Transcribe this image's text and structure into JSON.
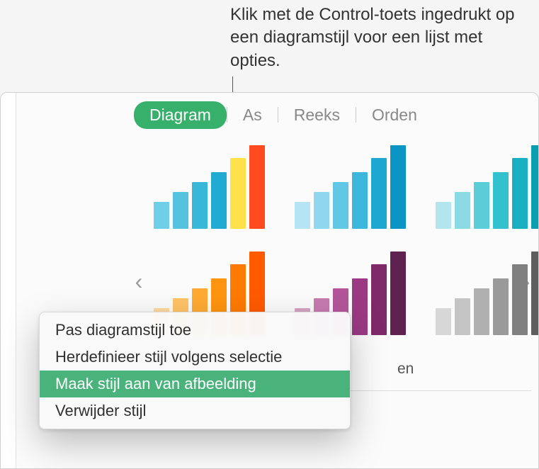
{
  "callout": {
    "text": "Klik met de Control-toets ingedrukt op een diagramstijl voor een lijst met opties."
  },
  "tabs": {
    "items": [
      {
        "label": "Diagram",
        "active": true
      },
      {
        "label": "As",
        "active": false
      },
      {
        "label": "Reeks",
        "active": false
      },
      {
        "label": "Orden",
        "active": false
      }
    ]
  },
  "styles": {
    "options_suffix": "en",
    "thumbnails": [
      {
        "name": "style-blue-yellow-red",
        "colors": [
          "#6fcfe7",
          "#55c3e0",
          "#39b7d9",
          "#22abd2",
          "#ffe24a",
          "#ff4a1f"
        ],
        "heights": [
          38,
          52,
          66,
          80,
          100,
          118
        ]
      },
      {
        "name": "style-blue-cyan",
        "colors": [
          "#b5e4f4",
          "#8fd7ee",
          "#62c7e5",
          "#3cb7db",
          "#1ea7d1",
          "#0a95c4"
        ],
        "heights": [
          38,
          52,
          66,
          80,
          100,
          118
        ]
      },
      {
        "name": "style-aqua-teal",
        "colors": [
          "#b3e6ec",
          "#8adae3",
          "#5bcdd9",
          "#33c0cf",
          "#18b0c1",
          "#0a9eb1"
        ],
        "heights": [
          38,
          52,
          66,
          80,
          100,
          118
        ]
      },
      {
        "name": "style-orange-gradient",
        "colors": [
          "#ffd9a0",
          "#ffc366",
          "#ffab33",
          "#ff9410",
          "#ff7a00",
          "#ff5a00"
        ],
        "heights": [
          38,
          52,
          66,
          80,
          100,
          118
        ]
      },
      {
        "name": "style-purple-red",
        "colors": [
          "#d7a3c5",
          "#c77bb0",
          "#b2559a",
          "#9b3a83",
          "#7f2a68",
          "#5f2250"
        ],
        "heights": [
          38,
          52,
          66,
          80,
          100,
          118
        ]
      },
      {
        "name": "style-grey-mono",
        "colors": [
          "#d7d7d7",
          "#c5c5c5",
          "#b0b0b0",
          "#9a9a9a",
          "#808080",
          "#5e5e5e"
        ],
        "heights": [
          38,
          52,
          66,
          80,
          100,
          118
        ]
      }
    ]
  },
  "context_menu": {
    "items": [
      {
        "label": "Pas diagramstijl toe",
        "highlighted": false
      },
      {
        "label": "Herdefinieer stijl volgens selectie",
        "highlighted": false
      },
      {
        "label": "Maak stijl aan van afbeelding",
        "highlighted": true
      },
      {
        "label": "Verwijder stijl",
        "highlighted": false
      }
    ]
  },
  "nav": {
    "left": "‹",
    "right": "›"
  }
}
